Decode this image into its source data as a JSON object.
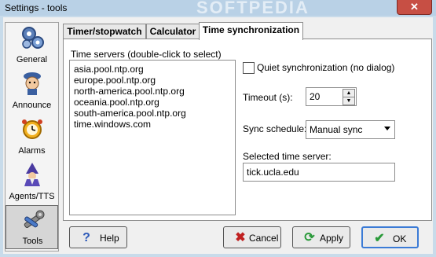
{
  "window": {
    "title": "Settings - tools",
    "close_label": "✕",
    "watermark": "SOFTPEDIA"
  },
  "sidebar": {
    "items": [
      {
        "label": "General",
        "icon": "gears-icon"
      },
      {
        "label": "Announce",
        "icon": "announcer-icon"
      },
      {
        "label": "Alarms",
        "icon": "alarm-clock-icon"
      },
      {
        "label": "Agents/TTS",
        "icon": "wizard-agent-icon"
      },
      {
        "label": "Tools",
        "icon": "wrench-icon"
      }
    ],
    "selected": "Tools"
  },
  "tabs": [
    {
      "label": "Timer/stopwatch"
    },
    {
      "label": "Calculator"
    },
    {
      "label": "Time synchronization"
    }
  ],
  "active_tab": "Time synchronization",
  "servers": {
    "label": "Time servers (double-click to select)",
    "items": [
      "asia.pool.ntp.org",
      "europe.pool.ntp.org",
      "north-america.pool.ntp.org",
      "oceania.pool.ntp.org",
      "south-america.pool.ntp.org",
      "time.windows.com"
    ]
  },
  "quiet_sync": {
    "label": "Quiet synchronization (no dialog)",
    "checked": false
  },
  "timeout": {
    "label": "Timeout (s):",
    "value": "20"
  },
  "schedule": {
    "label": "Sync schedule:",
    "value": "Manual sync"
  },
  "selected_server": {
    "label": "Selected time server:",
    "value": "tick.ucla.edu"
  },
  "buttons": {
    "help": "Help",
    "cancel": "Cancel",
    "apply": "Apply",
    "ok": "OK"
  },
  "colors": {
    "close": "#c74f44",
    "ok_accent": "#3b7bd6",
    "title_bar": "#b9d1e6"
  }
}
